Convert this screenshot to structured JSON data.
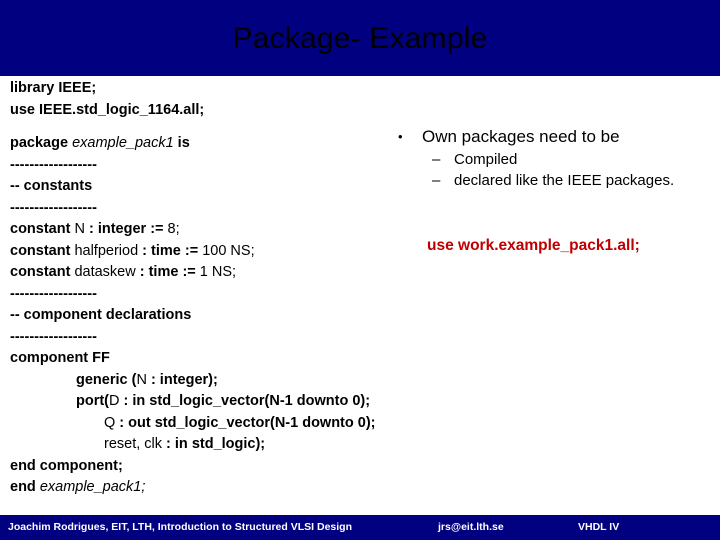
{
  "slide": {
    "title": "Package- Example",
    "header_color": "#000080",
    "footer_color": "#000080",
    "accent_red": "#C00000",
    "body_color": "#000000"
  },
  "code": {
    "lines": [
      {
        "segments": [
          {
            "t": "library IEEE;",
            "s": "kw"
          }
        ]
      },
      {
        "segments": [
          {
            "t": "use IEEE.std_logic_1164.all;",
            "s": "kw"
          }
        ]
      },
      {
        "blank": true
      },
      {
        "segments": [
          {
            "t": "package ",
            "s": "kw"
          },
          {
            "t": "example_pack1",
            "s": "it"
          },
          {
            "t": " is",
            "s": "kw"
          }
        ]
      },
      {
        "segments": [
          {
            "t": "------------------",
            "s": "rule"
          }
        ]
      },
      {
        "segments": [
          {
            "t": "-- constants",
            "s": "kw"
          }
        ]
      },
      {
        "segments": [
          {
            "t": "------------------",
            "s": "rule"
          }
        ]
      },
      {
        "segments": [
          {
            "t": "constant ",
            "s": "kw"
          },
          {
            "t": "N",
            "s": "id"
          },
          {
            "t": " : integer := ",
            "s": "kw"
          },
          {
            "t": "8;",
            "s": "id"
          }
        ]
      },
      {
        "segments": [
          {
            "t": "constant ",
            "s": "kw"
          },
          {
            "t": "halfperiod",
            "s": "id"
          },
          {
            "t": " : time := ",
            "s": "kw"
          },
          {
            "t": "100 NS;",
            "s": "id"
          }
        ]
      },
      {
        "segments": [
          {
            "t": "constant ",
            "s": "kw"
          },
          {
            "t": "dataskew",
            "s": "id"
          },
          {
            "t": " : time := ",
            "s": "kw"
          },
          {
            "t": "1 NS;",
            "s": "id"
          }
        ]
      },
      {
        "segments": [
          {
            "t": "------------------",
            "s": "rule"
          }
        ]
      },
      {
        "segments": [
          {
            "t": "-- component declarations",
            "s": "kw"
          }
        ]
      },
      {
        "segments": [
          {
            "t": "------------------",
            "s": "rule"
          }
        ]
      },
      {
        "segments": [
          {
            "t": "component FF",
            "s": "kw"
          }
        ]
      },
      {
        "indent": 1,
        "segments": [
          {
            "t": "generic (",
            "s": "kw"
          },
          {
            "t": "N",
            "s": "id"
          },
          {
            "t": " : integer);",
            "s": "kw"
          }
        ]
      },
      {
        "indent": 1,
        "segments": [
          {
            "t": "port(",
            "s": "kw"
          },
          {
            "t": "D",
            "s": "id"
          },
          {
            "t": " : in std_logic_vector(",
            "s": "kw"
          },
          {
            "t": "N-1 downto 0",
            "s": "kw"
          },
          {
            "t": ");",
            "s": "kw"
          }
        ]
      },
      {
        "indent": 2,
        "segments": [
          {
            "t": "Q",
            "s": "id"
          },
          {
            "t": " : out std_logic_vector(",
            "s": "kw"
          },
          {
            "t": "N-1 downto 0",
            "s": "kw"
          },
          {
            "t": ");",
            "s": "kw"
          }
        ]
      },
      {
        "indent": 2,
        "segments": [
          {
            "t": "reset, clk",
            "s": "id"
          },
          {
            "t": " : in std_logic);",
            "s": "kw"
          }
        ]
      },
      {
        "segments": [
          {
            "t": "end component;",
            "s": "kw"
          }
        ]
      },
      {
        "segments": [
          {
            "t": "end ",
            "s": "kw"
          },
          {
            "t": "example_pack1;",
            "s": "it"
          }
        ]
      }
    ]
  },
  "bullets": {
    "marker": "•",
    "sub_marker": "–",
    "items": [
      {
        "label": "Own packages need to be",
        "subitems": [
          "Compiled",
          "declared like the IEEE packages."
        ]
      }
    ]
  },
  "note": {
    "text": "use work.example_pack1.all;"
  },
  "footer": {
    "author": "Joachim Rodrigues, EIT, LTH, Introduction to Structured VLSI Design",
    "email": "jrs@eit.lth.se",
    "topic": "VHDL IV"
  }
}
